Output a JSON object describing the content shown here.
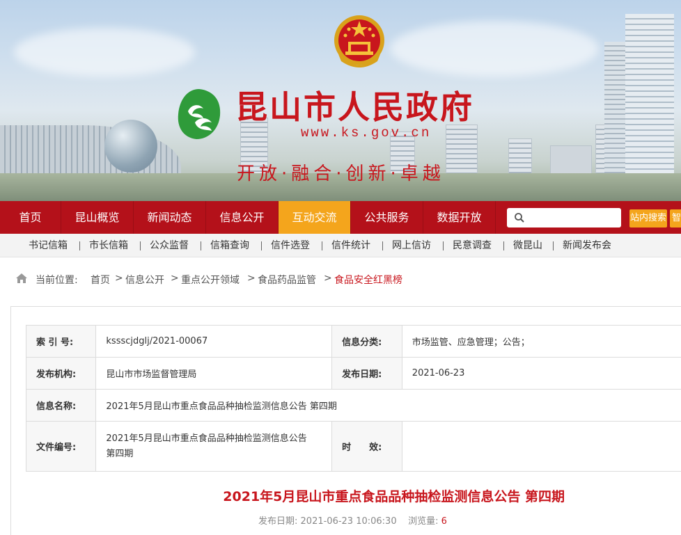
{
  "header": {
    "site_title": "昆山市人民政府",
    "site_url": "www.ks.gov.cn",
    "slogan": "开放·融合·创新·卓越",
    "brand_color": "#c8161d"
  },
  "nav": {
    "items": [
      "首页",
      "昆山概览",
      "新闻动态",
      "信息公开",
      "互动交流",
      "公共服务",
      "数据开放"
    ],
    "active": "互动交流",
    "search_placeholder": "",
    "search_button": "站内搜索",
    "search_button2": "智能",
    "bar_color": "#b4111a",
    "active_color": "#f4a51c"
  },
  "subnav": {
    "items": [
      "书记信箱",
      "市长信箱",
      "公众监督",
      "信箱查询",
      "信件选登",
      "信件统计",
      "网上信访",
      "民意调查",
      "微昆山",
      "新闻发布会"
    ]
  },
  "breadcrumb": {
    "label": "当前位置:",
    "items": [
      "首页",
      "信息公开",
      "重点公开领域",
      "食品药品监管"
    ],
    "separator": ">",
    "current": "食品安全红黑榜"
  },
  "meta": {
    "index_label": "索 引 号:",
    "index_value": "ksssсjdglj/2021-00067",
    "category_label": "信息分类:",
    "category_value": "市场监管、应急管理；公告；",
    "publisher_label": "发布机构:",
    "publisher_value": "昆山市市场监督管理局",
    "date_label": "发布日期:",
    "date_value": "2021-06-23",
    "name_label": "信息名称:",
    "name_value": "2021年5月昆山市重点食品品种抽检监测信息公告 第四期",
    "docno_label": "文件编号:",
    "docno_value": "2021年5月昆山市重点食品品种抽检监测信息公告第四期",
    "validity_label": "时　　效:",
    "validity_value": ""
  },
  "article": {
    "title": "2021年5月昆山市重点食品品种抽检监测信息公告 第四期",
    "published_label": "发布日期:",
    "published_value": "2021-06-23 10:06:30",
    "views_label": "浏览量:",
    "views_value": "6"
  }
}
